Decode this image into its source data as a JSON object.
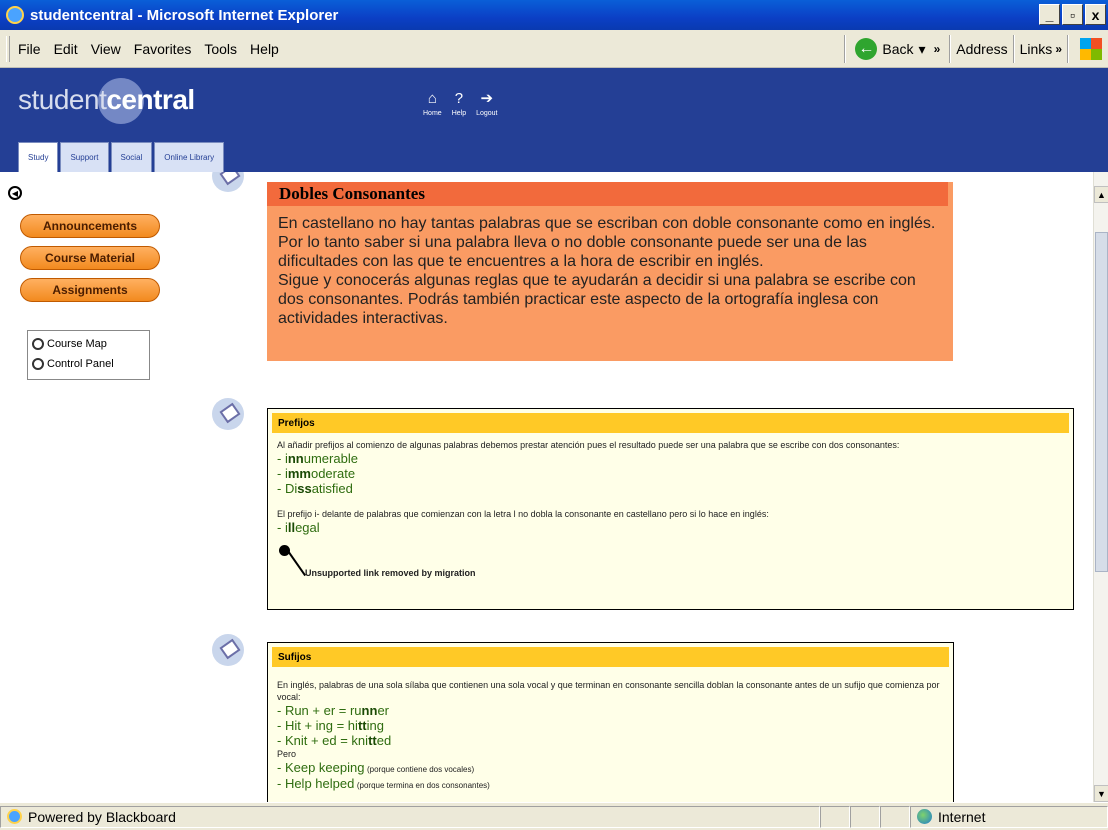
{
  "window": {
    "title": "studentcentral - Microsoft Internet Explorer",
    "controls": [
      "_",
      "▫",
      "x"
    ]
  },
  "menubar": {
    "items": [
      "File",
      "Edit",
      "View",
      "Favorites",
      "Tools",
      "Help"
    ],
    "back_label": "Back",
    "address_label": "Address",
    "links_label": "Links"
  },
  "header": {
    "logo_left": "student",
    "logo_right": "central",
    "icons": [
      {
        "label": "Home",
        "icon": "home-icon"
      },
      {
        "label": "Help",
        "icon": "help-icon"
      },
      {
        "label": "Logout",
        "icon": "logout-icon"
      }
    ],
    "tabs": [
      "Study",
      "Support",
      "Social",
      "Online Library"
    ],
    "active_tab": "Study"
  },
  "sidebar": {
    "buttons": [
      "Announcements",
      "Course Material",
      "Assignments"
    ],
    "tools": [
      "Course Map",
      "Control Panel"
    ]
  },
  "intro": {
    "title": "Dobles Consonantes",
    "paragraphs": [
      "En castellano no hay tantas palabras que se escriban con doble consonante como en inglés.",
      "Por lo tanto saber si una palabra lleva o no doble consonante puede ser una de las dificultades con las que te encuentres a la hora de escribir en inglés.",
      "Sigue y conocerás algunas reglas que te ayudarán a decidir si una palabra se escribe con dos consonantes. Podrás también practicar este aspecto de la ortografía inglesa con actividades interactivas."
    ]
  },
  "prefijos": {
    "title": "Prefijos",
    "text1": "Al añadir prefijos al comienzo de algunas palabras debemos prestar atención pues el resultado puede ser una palabra que se escribe con dos consonantes:",
    "examples": [
      {
        "pre": "- i",
        "bold": "nn",
        "post": "umerable"
      },
      {
        "pre": "- i",
        "bold": "mm",
        "post": "oderate"
      },
      {
        "pre": "- Di",
        "bold": "ss",
        "post": "atisfied"
      }
    ],
    "text2": "El prefijo i- delante de palabras que comienzan con la letra l no dobla la consonante en castellano pero si lo hace en inglés:",
    "example2": {
      "pre": "- i",
      "bold": "ll",
      "post": "egal"
    },
    "link_note": "Unsupported link removed by migration"
  },
  "sufijos": {
    "title": "Sufijos",
    "text1": "En inglés, palabras de una sola sílaba que contienen una sola vocal y que terminan en consonante sencilla doblan la consonante antes de un sufijo que comienza por vocal:",
    "examples": [
      {
        "pre": "- Run + er = ru",
        "bold": "nn",
        "post": "er"
      },
      {
        "pre": "- Hit + ing = hi",
        "bold": "tt",
        "post": "ing"
      },
      {
        "pre": "- Knit + ed = kni",
        "bold": "tt",
        "post": "ed"
      }
    ],
    "pero": "Pero",
    "counter": [
      {
        "word": "- Keep keeping",
        "note": "(porque contiene dos vocales)"
      },
      {
        "word": "- Help helped",
        "note": "(porque termina en dos consonantes)"
      }
    ]
  },
  "statusbar": {
    "text": "Powered by Blackboard",
    "zone": "Internet"
  },
  "colors": {
    "header_bg": "#243f95",
    "intro_bg": "#fa9b63",
    "intro_head": "#f26a3c",
    "card_head": "#ffc926",
    "example_green": "#2f6d10"
  }
}
